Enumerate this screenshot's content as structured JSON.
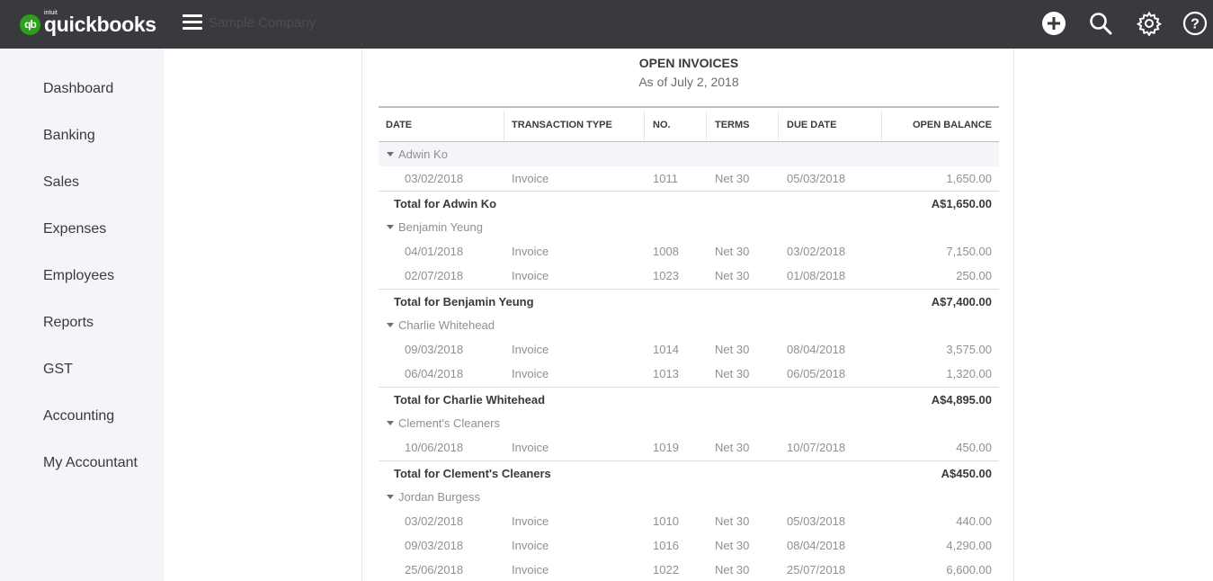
{
  "app": {
    "logo_text": "quickbooks",
    "logo_brand": "intuit",
    "logo_mark": "qb",
    "company": "Sample Company"
  },
  "topbar_icons": [
    "plus-circle-icon",
    "search-icon",
    "gear-icon",
    "help-icon"
  ],
  "sidebar": {
    "items": [
      {
        "label": "Dashboard"
      },
      {
        "label": "Banking"
      },
      {
        "label": "Sales"
      },
      {
        "label": "Expenses"
      },
      {
        "label": "Employees"
      },
      {
        "label": "Reports"
      },
      {
        "label": "GST"
      },
      {
        "label": "Accounting"
      },
      {
        "label": "My Accountant"
      }
    ]
  },
  "report": {
    "title": "OPEN INVOICES",
    "subtitle": "As of July 2, 2018",
    "columns": [
      "DATE",
      "TRANSACTION TYPE",
      "NO.",
      "TERMS",
      "DUE DATE",
      "OPEN BALANCE"
    ],
    "groups": [
      {
        "name": "Adwin Ko",
        "rows": [
          {
            "date": "03/02/2018",
            "type": "Invoice",
            "no": "1011",
            "terms": "Net 30",
            "due": "05/03/2018",
            "balance": "1,650.00"
          }
        ],
        "total_label": "Total for Adwin Ko",
        "total": "A$1,650.00"
      },
      {
        "name": "Benjamin Yeung",
        "rows": [
          {
            "date": "04/01/2018",
            "type": "Invoice",
            "no": "1008",
            "terms": "Net 30",
            "due": "03/02/2018",
            "balance": "7,150.00"
          },
          {
            "date": "02/07/2018",
            "type": "Invoice",
            "no": "1023",
            "terms": "Net 30",
            "due": "01/08/2018",
            "balance": "250.00"
          }
        ],
        "total_label": "Total for Benjamin Yeung",
        "total": "A$7,400.00"
      },
      {
        "name": "Charlie Whitehead",
        "rows": [
          {
            "date": "09/03/2018",
            "type": "Invoice",
            "no": "1014",
            "terms": "Net 30",
            "due": "08/04/2018",
            "balance": "3,575.00"
          },
          {
            "date": "06/04/2018",
            "type": "Invoice",
            "no": "1013",
            "terms": "Net 30",
            "due": "06/05/2018",
            "balance": "1,320.00"
          }
        ],
        "total_label": "Total for Charlie Whitehead",
        "total": "A$4,895.00"
      },
      {
        "name": "Clement's Cleaners",
        "rows": [
          {
            "date": "10/06/2018",
            "type": "Invoice",
            "no": "1019",
            "terms": "Net 30",
            "due": "10/07/2018",
            "balance": "450.00"
          }
        ],
        "total_label": "Total for Clement's Cleaners",
        "total": "A$450.00"
      },
      {
        "name": "Jordan Burgess",
        "rows": [
          {
            "date": "03/02/2018",
            "type": "Invoice",
            "no": "1010",
            "terms": "Net 30",
            "due": "05/03/2018",
            "balance": "440.00"
          },
          {
            "date": "09/03/2018",
            "type": "Invoice",
            "no": "1016",
            "terms": "Net 30",
            "due": "08/04/2018",
            "balance": "4,290.00"
          },
          {
            "date": "25/06/2018",
            "type": "Invoice",
            "no": "1022",
            "terms": "Net 30",
            "due": "25/07/2018",
            "balance": "6,600.00"
          }
        ]
      }
    ]
  },
  "colors": {
    "topbar": "#393a3d",
    "brand_green": "#2ca01c",
    "sidebar_bg": "#f4f5f8"
  }
}
